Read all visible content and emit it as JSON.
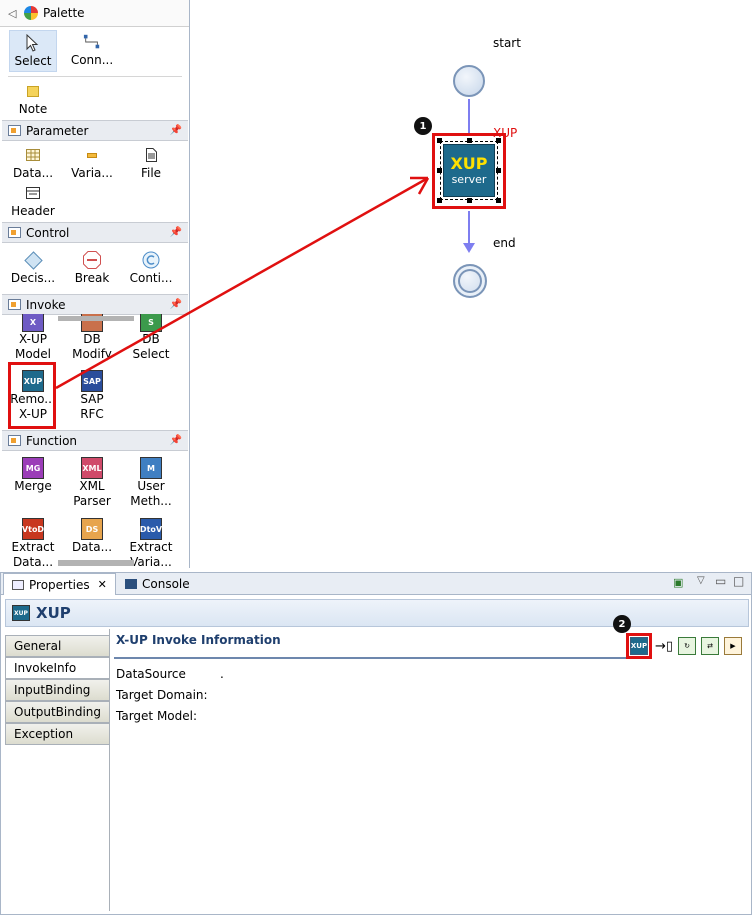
{
  "palette": {
    "title": "Palette",
    "tools": {
      "select": "Select",
      "connection": "Conn...",
      "note": "Note"
    },
    "groups": {
      "parameter": {
        "title": "Parameter",
        "items": [
          "Data...",
          "Varia...",
          "File",
          "Header"
        ]
      },
      "control": {
        "title": "Control",
        "items": [
          "Decis...",
          "Break",
          "Conti..."
        ]
      },
      "invoke": {
        "title": "Invoke",
        "items": [
          {
            "line1": "X-UP",
            "line2": "Model",
            "icon_text": "X"
          },
          {
            "line1": "DB",
            "line2": "Modify",
            "icon_text": ""
          },
          {
            "line1": "DB",
            "line2": "Select",
            "icon_text": "S"
          },
          {
            "line1": "Remo...",
            "line2": "X-UP",
            "icon_text": "XUP"
          },
          {
            "line1": "SAP",
            "line2": "RFC",
            "icon_text": "SAP"
          }
        ]
      },
      "function": {
        "title": "Function",
        "items": [
          {
            "line1": "Merge",
            "line2": "",
            "icon_text": "MG"
          },
          {
            "line1": "XML",
            "line2": "Parser",
            "icon_text": "XML"
          },
          {
            "line1": "User",
            "line2": "Meth...",
            "icon_text": "M"
          },
          {
            "line1": "Extract",
            "line2": "Data...",
            "icon_text": "VtoD"
          },
          {
            "line1": "Data...",
            "line2": "",
            "icon_text": "DS"
          },
          {
            "line1": "Extract",
            "line2": "Varia...",
            "icon_text": "DtoV"
          }
        ]
      }
    }
  },
  "canvas": {
    "start_label": "start",
    "end_label": "end",
    "node_label": "XUP",
    "node_title": "XUP",
    "node_subtitle": "server",
    "callout_1": "1"
  },
  "properties": {
    "tabs": [
      "Properties",
      "Console"
    ],
    "header_title": "XUP",
    "header_icon_text": "XUP",
    "side_tabs": [
      "General",
      "InvokeInfo",
      "InputBinding",
      "OutputBinding",
      "Exception"
    ],
    "section_title": "X-UP Invoke Information",
    "fields": [
      "DataSource",
      "Target Domain:",
      "Target Model:"
    ],
    "datasource_value": ".",
    "callout_2": "2",
    "toolbar_icon_text": "XUP"
  },
  "colors": {
    "accent": "#e01010",
    "node_bg": "#1e6a8c",
    "node_text": "#ffe000",
    "link": "#7e7ef0"
  }
}
